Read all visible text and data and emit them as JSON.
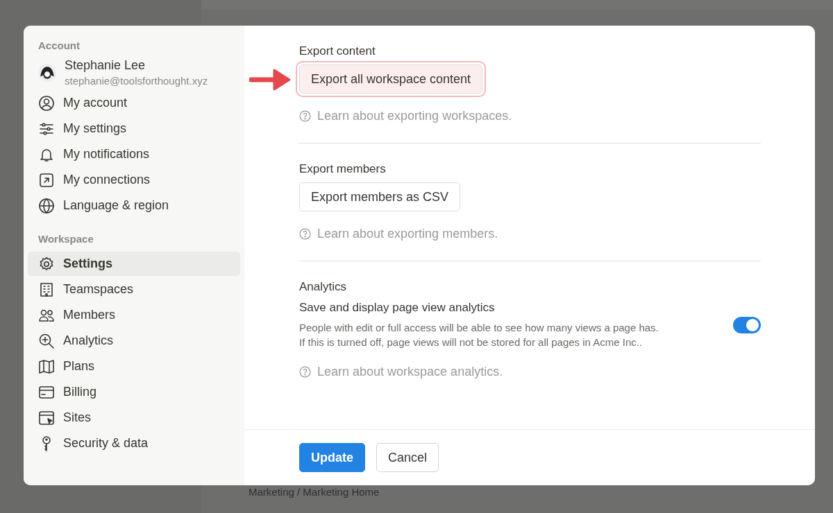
{
  "background": {
    "breadcrumb": "Marketing / Marketing Home"
  },
  "sidebar": {
    "sections": [
      {
        "heading": "Account",
        "user": {
          "name": "Stephanie Lee",
          "email": "stephanie@toolsforthought.xyz"
        },
        "items": [
          {
            "label": "My account",
            "selected": false
          },
          {
            "label": "My settings",
            "selected": false
          },
          {
            "label": "My notifications",
            "selected": false
          },
          {
            "label": "My connections",
            "selected": false
          },
          {
            "label": "Language & region",
            "selected": false
          }
        ]
      },
      {
        "heading": "Workspace",
        "items": [
          {
            "label": "Settings",
            "selected": true
          },
          {
            "label": "Teamspaces",
            "selected": false
          },
          {
            "label": "Members",
            "selected": false
          },
          {
            "label": "Analytics",
            "selected": false
          },
          {
            "label": "Plans",
            "selected": false
          },
          {
            "label": "Billing",
            "selected": false
          },
          {
            "label": "Sites",
            "selected": false
          },
          {
            "label": "Security & data",
            "selected": false
          }
        ]
      }
    ]
  },
  "content": {
    "sections": [
      {
        "kind": "button",
        "heading": "Export content",
        "button": {
          "label": "Export all workspace content",
          "highlighted": true
        },
        "help": "Learn about exporting workspaces."
      },
      {
        "kind": "button",
        "heading": "Export members",
        "button": {
          "label": "Export members as CSV",
          "highlighted": false
        },
        "help": "Learn about exporting members."
      },
      {
        "kind": "toggle",
        "heading": "Analytics",
        "setting": {
          "title": "Save and display page view analytics",
          "description": "People with edit or full access will be able to see how many views a page has. If this is turned off, page views will not be stored for all pages in Acme Inc..",
          "on": true
        },
        "help": "Learn about workspace analytics."
      }
    ]
  },
  "footer": {
    "buttons": [
      {
        "label": "Update",
        "kind": "primary"
      },
      {
        "label": "Cancel",
        "kind": "secondary"
      }
    ]
  }
}
